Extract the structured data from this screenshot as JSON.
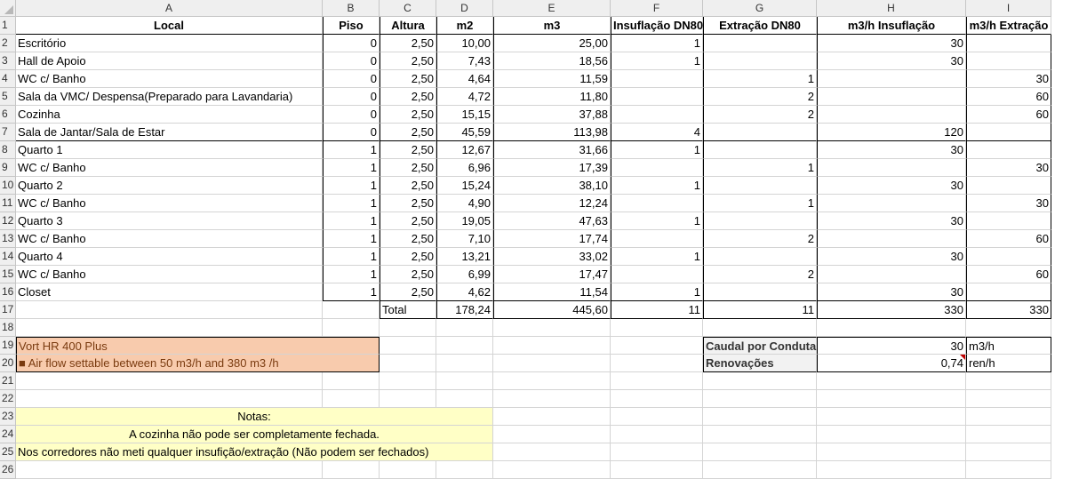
{
  "columns": [
    "A",
    "B",
    "C",
    "D",
    "E",
    "F",
    "G",
    "H",
    "I"
  ],
  "rows": [
    "1",
    "2",
    "3",
    "4",
    "5",
    "6",
    "7",
    "8",
    "9",
    "10",
    "11",
    "12",
    "13",
    "14",
    "15",
    "16",
    "17",
    "18",
    "19",
    "20",
    "21",
    "22",
    "23",
    "24",
    "25",
    "26"
  ],
  "headers": [
    "Local",
    "Piso",
    "Altura",
    "m2",
    "m3",
    "Insuflação DN80",
    "Extração DN80",
    "m3/h Insuflação",
    "m3/h Extração"
  ],
  "data": [
    [
      "Escritório",
      "0",
      "2,50",
      "10,00",
      "25,00",
      "1",
      "",
      "30",
      ""
    ],
    [
      "Hall de Apoio",
      "0",
      "2,50",
      "7,43",
      "18,56",
      "1",
      "",
      "30",
      ""
    ],
    [
      "WC c/ Banho",
      "0",
      "2,50",
      "4,64",
      "11,59",
      "",
      "1",
      "",
      "30"
    ],
    [
      "Sala da VMC/ Despensa(Preparado para Lavandaria)",
      "0",
      "2,50",
      "4,72",
      "11,80",
      "",
      "2",
      "",
      "60"
    ],
    [
      "Cozinha",
      "0",
      "2,50",
      "15,15",
      "37,88",
      "",
      "2",
      "",
      "60"
    ],
    [
      "Sala de Jantar/Sala de Estar",
      "0",
      "2,50",
      "45,59",
      "113,98",
      "4",
      "",
      "120",
      ""
    ],
    [
      "Quarto 1",
      "1",
      "2,50",
      "12,67",
      "31,66",
      "1",
      "",
      "30",
      ""
    ],
    [
      "WC c/ Banho",
      "1",
      "2,50",
      "6,96",
      "17,39",
      "",
      "1",
      "",
      "30"
    ],
    [
      "Quarto 2",
      "1",
      "2,50",
      "15,24",
      "38,10",
      "1",
      "",
      "30",
      ""
    ],
    [
      "WC c/ Banho",
      "1",
      "2,50",
      "4,90",
      "12,24",
      "",
      "1",
      "",
      "30"
    ],
    [
      "Quarto 3",
      "1",
      "2,50",
      "19,05",
      "47,63",
      "1",
      "",
      "30",
      ""
    ],
    [
      "WC c/ Banho",
      "1",
      "2,50",
      "7,10",
      "17,74",
      "",
      "2",
      "",
      "60"
    ],
    [
      "Quarto 4",
      "1",
      "2,50",
      "13,21",
      "33,02",
      "1",
      "",
      "30",
      ""
    ],
    [
      "WC c/ Banho",
      "1",
      "2,50",
      "6,99",
      "17,47",
      "",
      "2",
      "",
      "60"
    ],
    [
      "Closet",
      "1",
      "2,50",
      "4,62",
      "11,54",
      "1",
      "",
      "30",
      ""
    ]
  ],
  "totals": {
    "label": "Total",
    "m2": "178,24",
    "m3": "445,60",
    "insuf": "11",
    "extr": "11",
    "m3h_insuf": "330",
    "m3h_extr": "330"
  },
  "equipment": {
    "model": "Vort HR 400 Plus",
    "airflow": "■ Air flow settable between 50 m3/h and 380 m3 /h"
  },
  "summary": {
    "caudal_label": "Caudal por Conduta",
    "caudal_value": "30",
    "caudal_unit": "m3/h",
    "renov_label": "Renovações",
    "renov_value": "0,74",
    "renov_unit": "ren/h"
  },
  "notes": {
    "title": "Notas:",
    "line1": "A cozinha não pode ser completamente fechada.",
    "line2": "Nos corredores não meti qualquer insufição/extração (Não podem ser fechados)"
  },
  "colors": {
    "orange": "#f8cbad",
    "yellow": "#ffffc6",
    "header_gray": "#efefef"
  }
}
